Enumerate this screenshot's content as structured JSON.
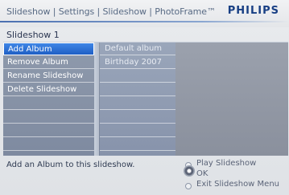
{
  "header": {
    "breadcrumb": [
      "Slideshow",
      "Settings",
      "Slideshow",
      "PhotoFrame™"
    ],
    "breadcrumb_separator": " | ",
    "brand": "PHILIPS"
  },
  "subtitle": "Slideshow 1",
  "menu": {
    "items": [
      {
        "label": "Add Album",
        "selected": true
      },
      {
        "label": "Remove Album",
        "selected": false
      },
      {
        "label": "Rename Slideshow",
        "selected": false
      },
      {
        "label": "Delete Slideshow",
        "selected": false
      },
      {
        "label": "",
        "selected": false
      },
      {
        "label": "",
        "selected": false
      },
      {
        "label": "",
        "selected": false
      },
      {
        "label": "",
        "selected": false
      }
    ]
  },
  "albums": {
    "items": [
      "Default album",
      "Birthday 2007",
      "",
      "",
      "",
      "",
      "",
      ""
    ]
  },
  "footer": {
    "hint": "Add an Album to this slideshow.",
    "legend": [
      {
        "label": "Play Slideshow",
        "icon": "radio-dot-icon"
      },
      {
        "label": "OK",
        "icon": "nav-wheel-icon"
      },
      {
        "label": "Exit Slideshow Menu",
        "icon": "radio-dot-icon"
      }
    ]
  },
  "colors": {
    "brand_blue": "#183f84",
    "selection_blue": "#2a6fd6",
    "panel_gray": "#808ba0"
  }
}
